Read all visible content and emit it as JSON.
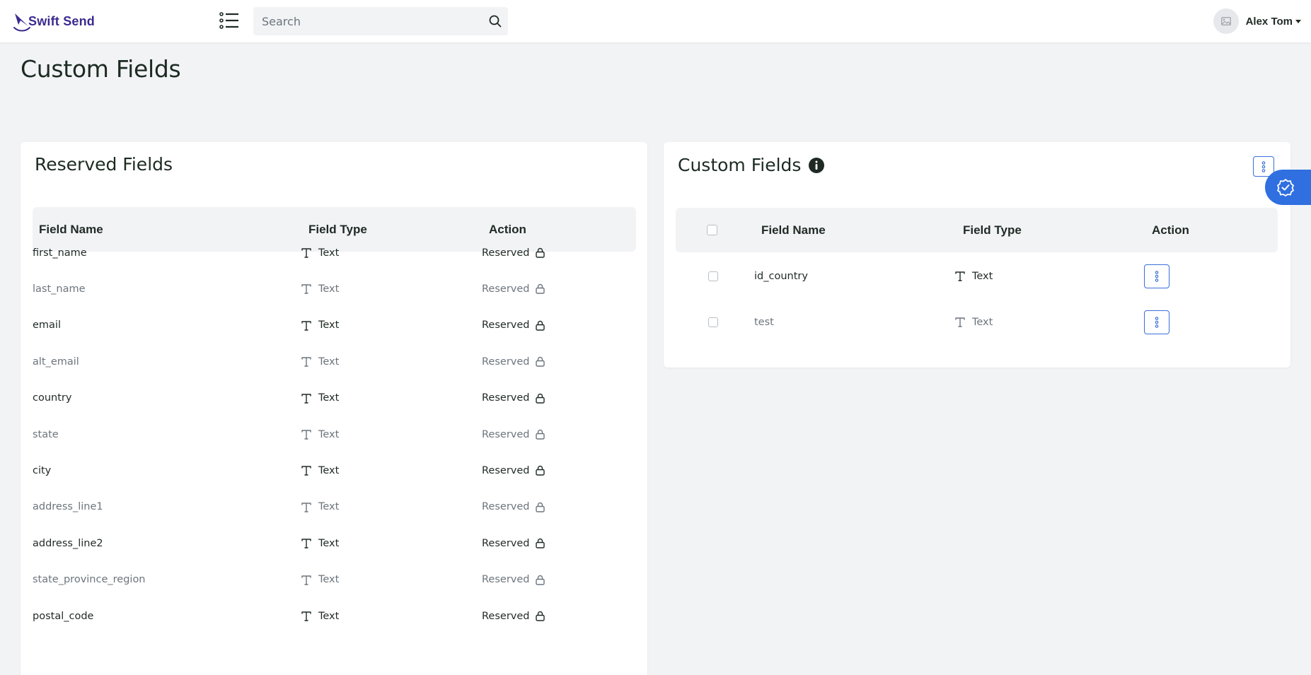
{
  "app": {
    "logo_text": "Swift Send"
  },
  "header": {
    "search_placeholder": "Search",
    "user_name": "Alex Tom"
  },
  "page": {
    "title": "Custom Fields"
  },
  "reserved": {
    "title": "Reserved Fields",
    "columns": {
      "name": "Field Name",
      "type": "Field Type",
      "action": "Action"
    },
    "rows": [
      {
        "name": "first_name",
        "type": "Text",
        "action": "Reserved"
      },
      {
        "name": "last_name",
        "type": "Text",
        "action": "Reserved"
      },
      {
        "name": "email",
        "type": "Text",
        "action": "Reserved"
      },
      {
        "name": "alt_email",
        "type": "Text",
        "action": "Reserved"
      },
      {
        "name": "country",
        "type": "Text",
        "action": "Reserved"
      },
      {
        "name": "state",
        "type": "Text",
        "action": "Reserved"
      },
      {
        "name": "city",
        "type": "Text",
        "action": "Reserved"
      },
      {
        "name": "address_line1",
        "type": "Text",
        "action": "Reserved"
      },
      {
        "name": "address_line2",
        "type": "Text",
        "action": "Reserved"
      },
      {
        "name": "state_province_region",
        "type": "Text",
        "action": "Reserved"
      },
      {
        "name": "postal_code",
        "type": "Text",
        "action": "Reserved"
      }
    ]
  },
  "custom": {
    "title": "Custom Fields",
    "columns": {
      "name": "Field Name",
      "type": "Field Type",
      "action": "Action"
    },
    "rows": [
      {
        "name": "id_country",
        "type": "Text"
      },
      {
        "name": "test",
        "type": "Text"
      }
    ]
  },
  "icons": {
    "menu": "list-icon",
    "search": "search-icon",
    "avatar": "image-placeholder-icon",
    "field_type": "text-type-icon",
    "reserved": "lock-icon",
    "row_action": "kebab-icon",
    "info": "info-icon",
    "float_badge": "verified-badge-icon"
  },
  "colors": {
    "brand": "#3b2a8f",
    "accent": "#2f6fe0",
    "action_border": "#3b6fd8",
    "background": "#f2f3f5"
  }
}
